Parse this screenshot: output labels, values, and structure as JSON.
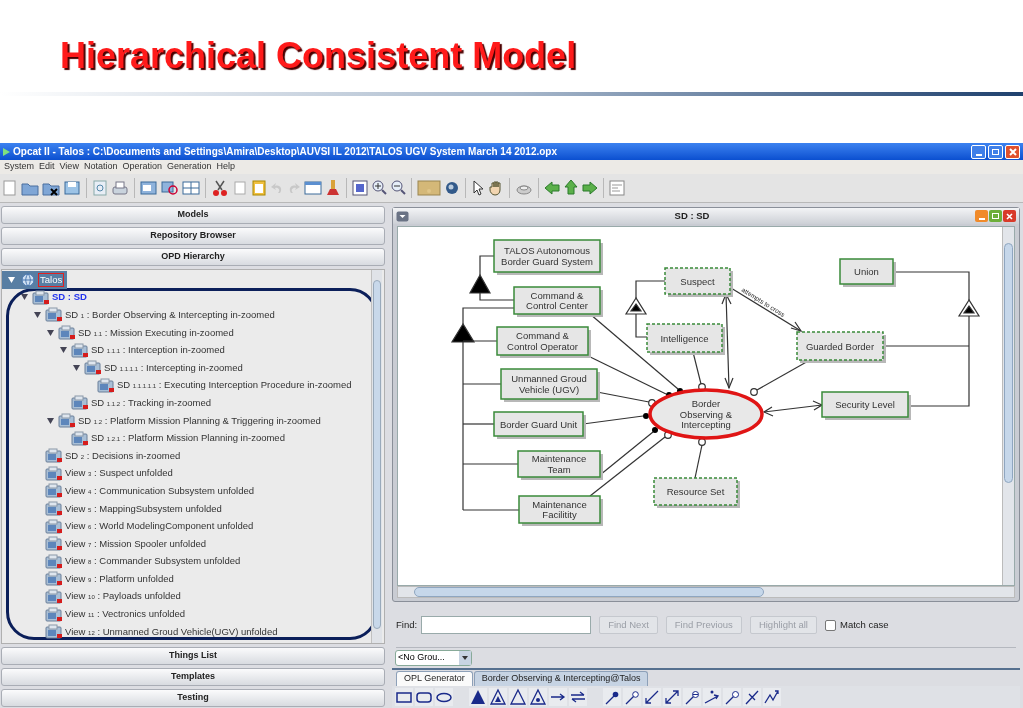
{
  "slide": {
    "title": "Hierarchical Consistent Model"
  },
  "window": {
    "title": "Opcat II - Talos : C:\\Documents and Settings\\Amira\\Desktop\\AUVSI IL 2012\\TALOS UGV System March 14 2012.opx"
  },
  "menu": [
    "System",
    "Edit",
    "View",
    "Notation",
    "Operation",
    "Generation",
    "Help"
  ],
  "panels_top": [
    "Models",
    "Repository Browser",
    "OPD Hierarchy"
  ],
  "tree": {
    "label": "Talos",
    "kind": "model",
    "selected": true,
    "open": false,
    "expanded": true,
    "children": [
      {
        "label": "SD : SD",
        "kind": "diagram",
        "selected": false,
        "open": true,
        "expanded": true,
        "children": [
          {
            "label": "SD $_{1}$ : Border  Observing & Intercepting in-zoomed",
            "kind": "diagram",
            "selected": false,
            "open": false,
            "expanded": true,
            "children": [
              {
                "label": "SD $_{1.1}$ : Mission Executing in-zoomed",
                "kind": "diagram",
                "selected": false,
                "open": false,
                "expanded": true,
                "children": [
                  {
                    "label": "SD $_{1.1.1}$ : Interception in-zoomed",
                    "kind": "diagram",
                    "selected": false,
                    "open": false,
                    "expanded": true,
                    "children": [
                      {
                        "label": "SD $_{1.1.1.1}$ : Intercepting in-zoomed",
                        "kind": "diagram",
                        "selected": false,
                        "open": false,
                        "expanded": true,
                        "children": [
                          {
                            "label": "SD $_{1.1.1.1.1}$ : Executing Interception Procedure in-zoomed",
                            "kind": "diagram",
                            "selected": false,
                            "open": false
                          }
                        ]
                      }
                    ]
                  },
                  {
                    "label": "SD $_{1.1.2}$ : Tracking in-zoomed",
                    "kind": "diagram",
                    "selected": false,
                    "open": false
                  }
                ]
              },
              {
                "label": "SD $_{1.2}$ : Platform Mission Planning & Triggering in-zoomed",
                "kind": "diagram",
                "selected": false,
                "open": false,
                "expanded": true,
                "children": [
                  {
                    "label": "SD $_{1.2.1}$ : Platform Mission Planning in-zoomed",
                    "kind": "diagram",
                    "selected": false,
                    "open": false
                  }
                ]
              }
            ]
          },
          {
            "label": "SD $_{2}$ : Decisions in-zoomed",
            "kind": "diagram",
            "selected": false,
            "open": false
          },
          {
            "label": "View $_{3}$ : Suspect unfolded",
            "kind": "diagram",
            "selected": false,
            "open": false
          },
          {
            "label": "View $_{4}$ : Communication Subsystem unfolded",
            "kind": "diagram",
            "selected": false,
            "open": false
          },
          {
            "label": "View $_{5}$ : MappingSubsystem unfolded",
            "kind": "diagram",
            "selected": false,
            "open": false
          },
          {
            "label": "View $_{6}$ : World ModelingComponent unfolded",
            "kind": "diagram",
            "selected": false,
            "open": false
          },
          {
            "label": "View $_{7}$ : Mission Spooler unfolded",
            "kind": "diagram",
            "selected": false,
            "open": false
          },
          {
            "label": "View $_{8}$ : Commander Subsystem unfolded",
            "kind": "diagram",
            "selected": false,
            "open": false
          },
          {
            "label": "View $_{9}$ : Platform unfolded",
            "kind": "diagram",
            "selected": false,
            "open": false
          },
          {
            "label": "View $_{10}$ : Payloads unfolded",
            "kind": "diagram",
            "selected": false,
            "open": false
          },
          {
            "label": "View $_{11}$ : Vectronics unfolded",
            "kind": "diagram",
            "selected": false,
            "open": false
          },
          {
            "label": "View $_{12}$ : Unmanned Groud Vehicle(UGV) unfolded",
            "kind": "diagram",
            "selected": false,
            "open": false
          }
        ]
      }
    ]
  },
  "panels_bottom": [
    "Things List",
    "Templates",
    "Testing"
  ],
  "diagram": {
    "title": "SD : SD",
    "things": [
      {
        "label": "TALOS Autonomous\nBorder Guard System",
        "kind": "object",
        "environmental": false
      },
      {
        "label": "Command &\nControl Center",
        "kind": "object",
        "environmental": false
      },
      {
        "label": "Command &\nControl Operator",
        "kind": "object",
        "environmental": false
      },
      {
        "label": "Unmanned Groud\nVehicle (UGV)",
        "kind": "object",
        "environmental": false
      },
      {
        "label": "Border Guard Unit",
        "kind": "object",
        "environmental": false
      },
      {
        "label": "Maintenance\nTeam",
        "kind": "object",
        "environmental": false
      },
      {
        "label": "Maintenance\nFacilitity",
        "kind": "object",
        "environmental": false
      },
      {
        "label": "Suspect",
        "kind": "object",
        "environmental": true
      },
      {
        "label": "Intelligence",
        "kind": "object",
        "environmental": true
      },
      {
        "label": "Guarded Border",
        "kind": "object",
        "environmental": true
      },
      {
        "label": "Union",
        "kind": "object",
        "environmental": false
      },
      {
        "label": "Security Level",
        "kind": "object",
        "environmental": false
      },
      {
        "label": "Border\nObserving &\nIntercepting",
        "kind": "process",
        "environmental": false
      },
      {
        "label": "Resource Set",
        "kind": "object",
        "environmental": true
      }
    ],
    "link_label": "attempts to cross"
  },
  "find": {
    "label": "Find:",
    "buttons": [
      {
        "label": "Find Next",
        "disabled": true
      },
      {
        "label": "Find Previous",
        "disabled": true
      },
      {
        "label": "Highlight all",
        "disabled": true
      }
    ],
    "match_case": {
      "label": "Match case",
      "checked": false
    }
  },
  "group_select": {
    "value": "<No Grou..."
  },
  "tabs": [
    {
      "label": "OPL Generator",
      "selected": true
    },
    {
      "label": "Border  Observing & Intercepting@Talos",
      "selected": false
    }
  ]
}
